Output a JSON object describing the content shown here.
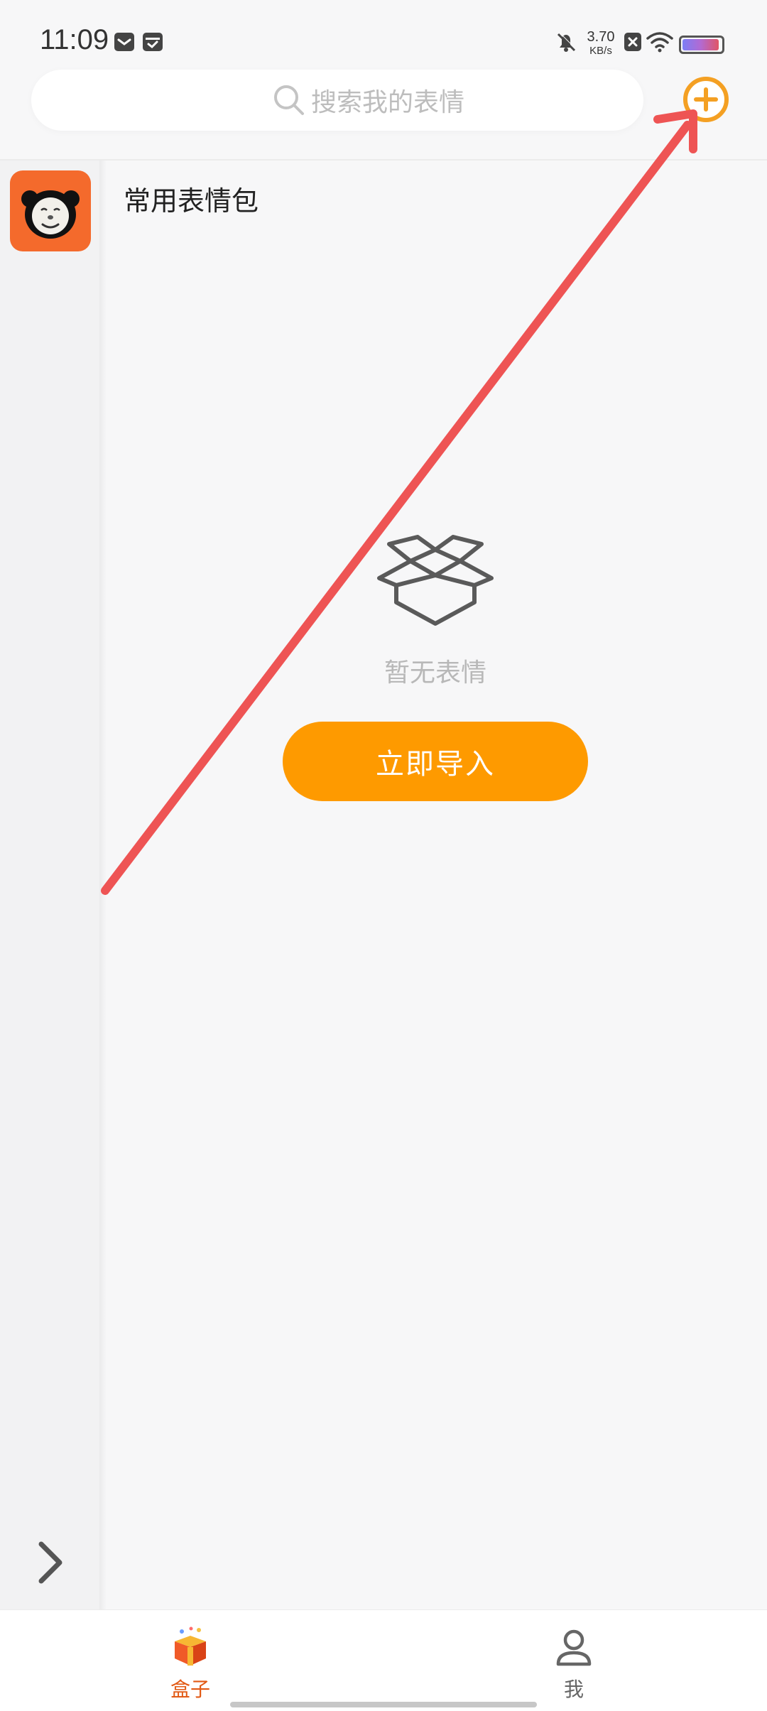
{
  "status_bar": {
    "time": "11:09",
    "net_speed": "3.70",
    "net_unit": "KB/s",
    "battery_level": 0.95,
    "icons": [
      "mail-icon",
      "calendar-icon",
      "bell-off-icon",
      "sim-off-icon",
      "wifi-icon",
      "battery-icon"
    ]
  },
  "search": {
    "placeholder": "搜索我的表情"
  },
  "header": {
    "add_icon": "plus-circle-icon",
    "accent": "#fe9a00"
  },
  "sidebar": {
    "items": [
      {
        "icon": "panda-meme-icon",
        "bg": "#f46a2c"
      }
    ],
    "expand_icon": "chevron-right-icon"
  },
  "main": {
    "pack_title": "常用表情包",
    "empty_icon": "open-box-icon",
    "empty_text": "暂无表情",
    "import_label": "立即导入"
  },
  "tabs": [
    {
      "label": "盒子",
      "icon": "gift-box-icon",
      "active": true,
      "color": "#e25a15"
    },
    {
      "label": "我",
      "icon": "person-icon",
      "active": false,
      "color": "#666666"
    }
  ],
  "annotation": {
    "arrow_color": "#ee5454"
  }
}
